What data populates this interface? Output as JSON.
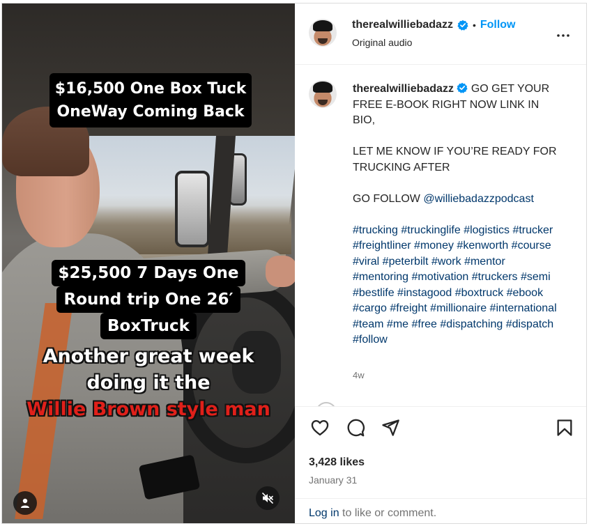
{
  "video": {
    "caption_top": "$16,500 One Box Tuck OneWay Coming Back",
    "caption_mid": [
      "$25,500 7 Days One",
      "Round trip One 26′",
      "BoxTruck"
    ],
    "caption_bottom_white": "Another great week doing it the",
    "caption_bottom_red": "Willie Brown style man"
  },
  "header": {
    "username": "therealwilliebadazz",
    "separator": "•",
    "follow_label": "Follow",
    "subtitle": "Original audio"
  },
  "caption": {
    "username": "therealwilliebadazz",
    "text_main": "GO GET YOUR FREE E-BOOK RIGHT NOW LINK IN BIO,\n\nLET ME KNOW IF YOU’RE READY FOR TRUCKING AFTER\n\nGO FOLLOW ",
    "mention": "@williebadazzpodcast",
    "hashtags": "#trucking #truckinglife #logistics #trucker #freightliner #money #kenworth #course #viral #peterbilt #work #mentor #mentoring #motivation #truckers #semi #bestlife #instagood #boxtruck #ebook #cargo #freight #millionaire #international #team #me #free #dispatching #dispatch #follow",
    "time": "4w"
  },
  "stats": {
    "likes": "3,428 likes",
    "date": "January 31"
  },
  "footer": {
    "login_link": "Log in",
    "login_rest": " to like or comment."
  },
  "colors": {
    "follow_blue": "#0095f6",
    "link_blue": "#00376b",
    "muted_gray": "#737373",
    "caption_red": "#e0201a"
  },
  "icons": [
    "verified-badge-icon",
    "more-options-icon",
    "heart-icon",
    "comment-icon",
    "share-icon",
    "bookmark-icon",
    "user-tag-icon",
    "mute-icon"
  ]
}
